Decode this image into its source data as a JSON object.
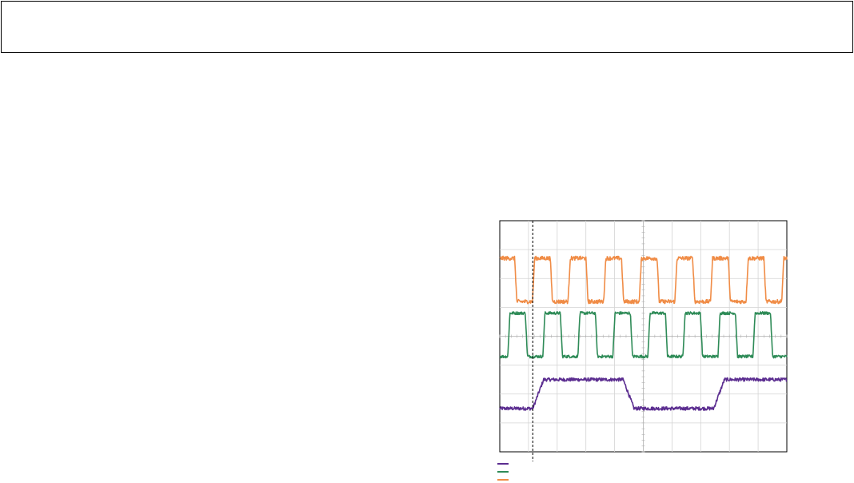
{
  "header": {
    "title": ""
  },
  "chart_data": {
    "type": "line",
    "title": "",
    "xlabel": "",
    "ylabel": "",
    "xlim": [
      0,
      10
    ],
    "ylim": [
      0,
      8
    ],
    "grid": true,
    "grid_divisions": {
      "x": 10,
      "y": 8
    },
    "cursor_x": 1.15,
    "series": [
      {
        "color": "#5b2d90",
        "shape": "square",
        "period": 6.3,
        "phase": 1.15,
        "high": 2.5,
        "low": 1.5,
        "noise": 0.12
      },
      {
        "color": "#2e8b57",
        "shape": "square",
        "period": 1.22,
        "phase": 0.28,
        "high": 4.8,
        "low": 3.3,
        "noise": 0.1
      },
      {
        "color": "#f08c46",
        "shape": "square",
        "period": 1.24,
        "phase": -0.1,
        "high": 6.7,
        "low": 5.2,
        "noise": 0.14
      }
    ]
  },
  "legend": [
    {
      "color": "#5b2d90",
      "label": ""
    },
    {
      "color": "#2e8b57",
      "label": ""
    },
    {
      "color": "#f08c46",
      "label": ""
    }
  ]
}
